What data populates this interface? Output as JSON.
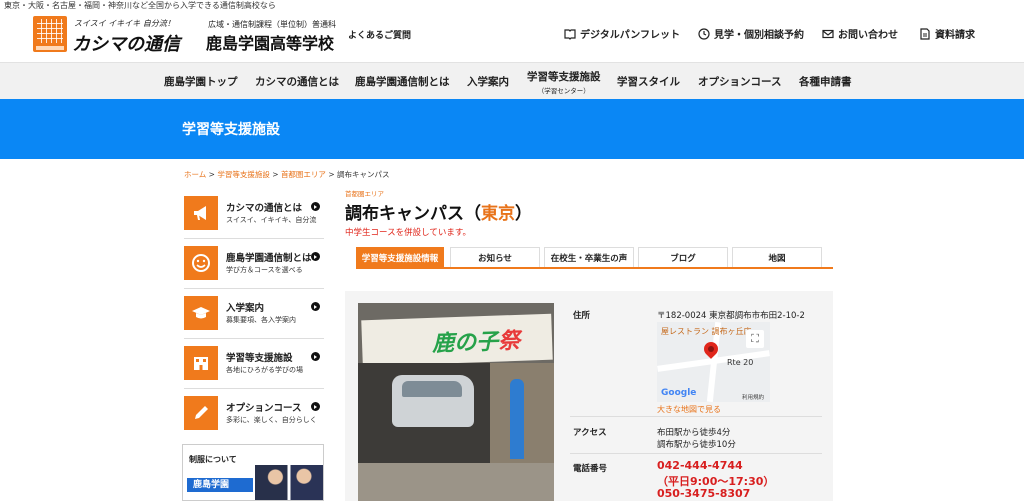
{
  "top_tagline": "東京・大阪・名古屋・福岡・神奈川など全国から入学できる通信制高校なら",
  "header": {
    "logo_subtitle": "スイスイ イキイキ 自分流！",
    "logo_title": "カシマの通信",
    "school_subtitle": "広域・通信制課程（単位制）普通科",
    "school_title": "鹿島学園高等学校",
    "faq": "よくあるご質問",
    "links": [
      {
        "label": "デジタルパンフレット",
        "icon": "book-icon"
      },
      {
        "label": "見学・個別相談予約",
        "icon": "clock-icon"
      },
      {
        "label": "お問い合わせ",
        "icon": "mail-icon"
      },
      {
        "label": "資料請求",
        "icon": "document-icon"
      }
    ]
  },
  "nav": [
    {
      "label": "鹿島学園トップ",
      "sub": ""
    },
    {
      "label": "カシマの通信とは",
      "sub": ""
    },
    {
      "label": "鹿島学園通信制とは",
      "sub": ""
    },
    {
      "label": "入学案内",
      "sub": ""
    },
    {
      "label": "学習等支援施設",
      "sub": "（学習センター）"
    },
    {
      "label": "学習スタイル",
      "sub": ""
    },
    {
      "label": "オプションコース",
      "sub": ""
    },
    {
      "label": "各種申請書",
      "sub": ""
    }
  ],
  "banner_title": "学習等支援施設",
  "breadcrumb": {
    "items": [
      "ホーム",
      "学習等支援施設",
      "首都圏エリア"
    ],
    "current": "調布キャンパス",
    "sep": ">"
  },
  "sidebar": [
    {
      "title": "カシマの通信とは",
      "sub": "スイスイ、イキイキ、自分流",
      "icon": "megaphone-icon"
    },
    {
      "title": "鹿島学園通信制とは",
      "sub": "学び方＆コースを選べる",
      "icon": "smile-icon"
    },
    {
      "title": "入学案内",
      "sub": "募集要項、各入学案内",
      "icon": "graduation-cap-icon"
    },
    {
      "title": "学習等支援施設",
      "sub": "各地にひろがる学びの場",
      "icon": "building-icon"
    },
    {
      "title": "オプションコース",
      "sub": "多彩に、楽しく、自分らしく",
      "icon": "pencil-icon"
    }
  ],
  "uniform": {
    "label": "制服について",
    "school": "鹿島学園"
  },
  "campus": {
    "area": "首都圏エリア",
    "title_main": "調布キャンパス（",
    "title_highlight": "東京",
    "title_end": "）",
    "note": "中学生コースを併設しています。"
  },
  "tabs": [
    "学習等支援施設情報",
    "お知らせ",
    "在校生・卒業生の声",
    "ブログ",
    "地図"
  ],
  "photo": {
    "sign_text_a": "鹿の子",
    "sign_text_b": "祭"
  },
  "info": {
    "address_label": "住所",
    "address_value": "〒182-0024 東京都調布市布田2-10-2",
    "map": {
      "label": "屋レストラン 調布ヶ丘店",
      "road": "Rte 20",
      "google": "Google",
      "terms": "利用規約",
      "fullscreen": "⛶",
      "link": "大きな地図で見る"
    },
    "access_label": "アクセス",
    "access_values": [
      "布田駅から徒歩4分",
      "調布駅から徒歩10分"
    ],
    "phone_label": "電話番号",
    "phones": [
      "042-444-4744",
      "（平日9:00〜17:30）",
      "050-3475-8307"
    ]
  }
}
